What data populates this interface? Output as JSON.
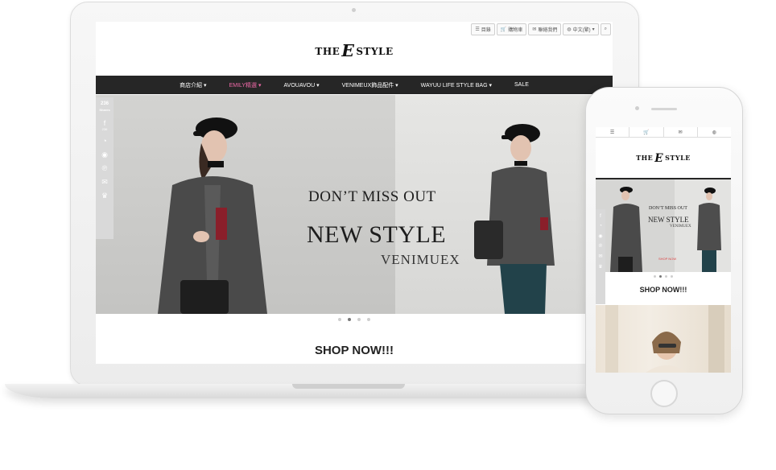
{
  "utility_bar": {
    "items": [
      {
        "icon": "list-icon",
        "label": "目錄"
      },
      {
        "icon": "cart-icon",
        "label": "購物車"
      },
      {
        "icon": "chat-icon",
        "label": "聯絡我們"
      },
      {
        "icon": "globe-icon",
        "label": "中文(繁)"
      },
      {
        "icon": "search-icon",
        "label": ""
      }
    ]
  },
  "logo": {
    "left": "THE",
    "mark": "E",
    "right": "STYLE"
  },
  "nav": {
    "items": [
      {
        "label": "商店介紹",
        "caret": "▾"
      },
      {
        "label": "EMILY精選",
        "caret": "▾",
        "highlight": true
      },
      {
        "label": "AVOUAVOU",
        "caret": "▾"
      },
      {
        "label": "VENIMEUX飾品配件",
        "caret": "▾"
      },
      {
        "label": "WAYUU LIFE STYLE BAG",
        "caret": "▾"
      },
      {
        "label": "SALE",
        "caret": ""
      }
    ],
    "highlight_color": "#f16aa9"
  },
  "share": {
    "count": "236",
    "label": "Shares",
    "fb_count": "236"
  },
  "hero": {
    "line1": "DON’T MISS OUT",
    "line2": "NEW STYLE",
    "line3": "VENIMUEX"
  },
  "carousel": {
    "dots": 4,
    "active_index": 1
  },
  "shop_now": "SHOP NOW!!!",
  "phone": {
    "shop_now": "SHOP NOW!!!",
    "hero_button": "SHOP NOW"
  }
}
